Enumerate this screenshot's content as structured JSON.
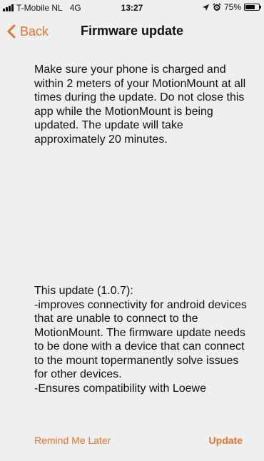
{
  "status_bar": {
    "carrier": "T-Mobile NL",
    "network": "4G",
    "time": "13:27",
    "battery": "75%",
    "battery_level": 0.75,
    "signal_bars": 4,
    "icons": [
      "signal-icon",
      "location-arrow-icon",
      "alarm-icon",
      "battery-icon"
    ]
  },
  "nav": {
    "back_label": "Back",
    "title": "Firmware update"
  },
  "message": {
    "text": "Make sure your phone is charged and within 2 meters of your MotionMount at all times during the update. Do not close this app while the MotionMount is being updated. The update will take approximately 20 minutes."
  },
  "changelog": {
    "heading": "This update (1.0.7):",
    "item1": "-improves connectivity for android devices that are unable to connect to the MotionMount. The firmware update needs to be done with a device that can connect to the mount topermanently solve issues for other devices.",
    "item2": "-Ensures compatibility with Loewe"
  },
  "actions": {
    "remind_label": "Remind Me Later",
    "update_label": "Update"
  },
  "colors": {
    "accent": "#e8742a",
    "background": "#efefef",
    "text": "#111111"
  }
}
